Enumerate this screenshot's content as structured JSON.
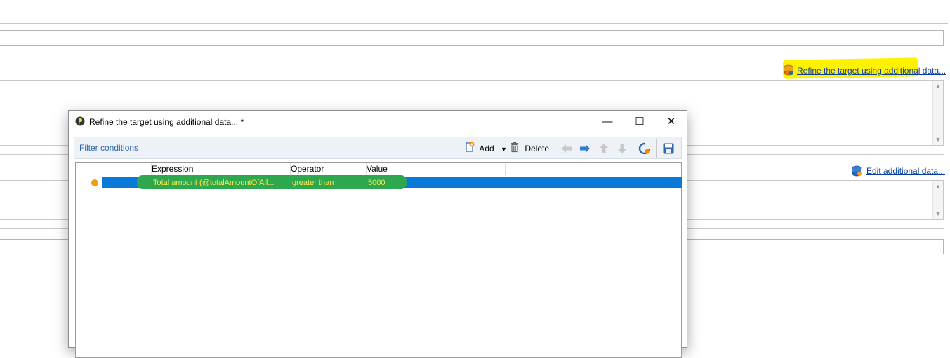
{
  "background": {
    "refine_link": "Refine the target using additional data...",
    "edit_link": "Edit additional data..."
  },
  "dialog": {
    "title": "Refine the target using additional data... *",
    "minimize_glyph": "—",
    "maximize_glyph": "☐",
    "close_glyph": "✕",
    "toolbar": {
      "title": "Filter conditions",
      "add_label": "Add",
      "delete_label": "Delete"
    },
    "grid": {
      "columns": [
        "Expression",
        "Operator",
        "Value"
      ],
      "rows": [
        {
          "expression": "Total amount (@totalAmountOfAll...",
          "operator": "greater than",
          "value": "5000"
        }
      ]
    }
  },
  "colors": {
    "accent": "#0a78d7",
    "highlight_yellow": "#fff200",
    "highlight_green": "#2ea84e",
    "link": "#0b3f9e"
  },
  "icons": [
    "database-icon",
    "dialog-app-icon",
    "add-icon",
    "delete-icon",
    "arrow-left-icon",
    "arrow-right-icon",
    "arrow-up-icon",
    "arrow-down-icon",
    "refresh-icon",
    "save-icon",
    "status-dot-icon"
  ]
}
